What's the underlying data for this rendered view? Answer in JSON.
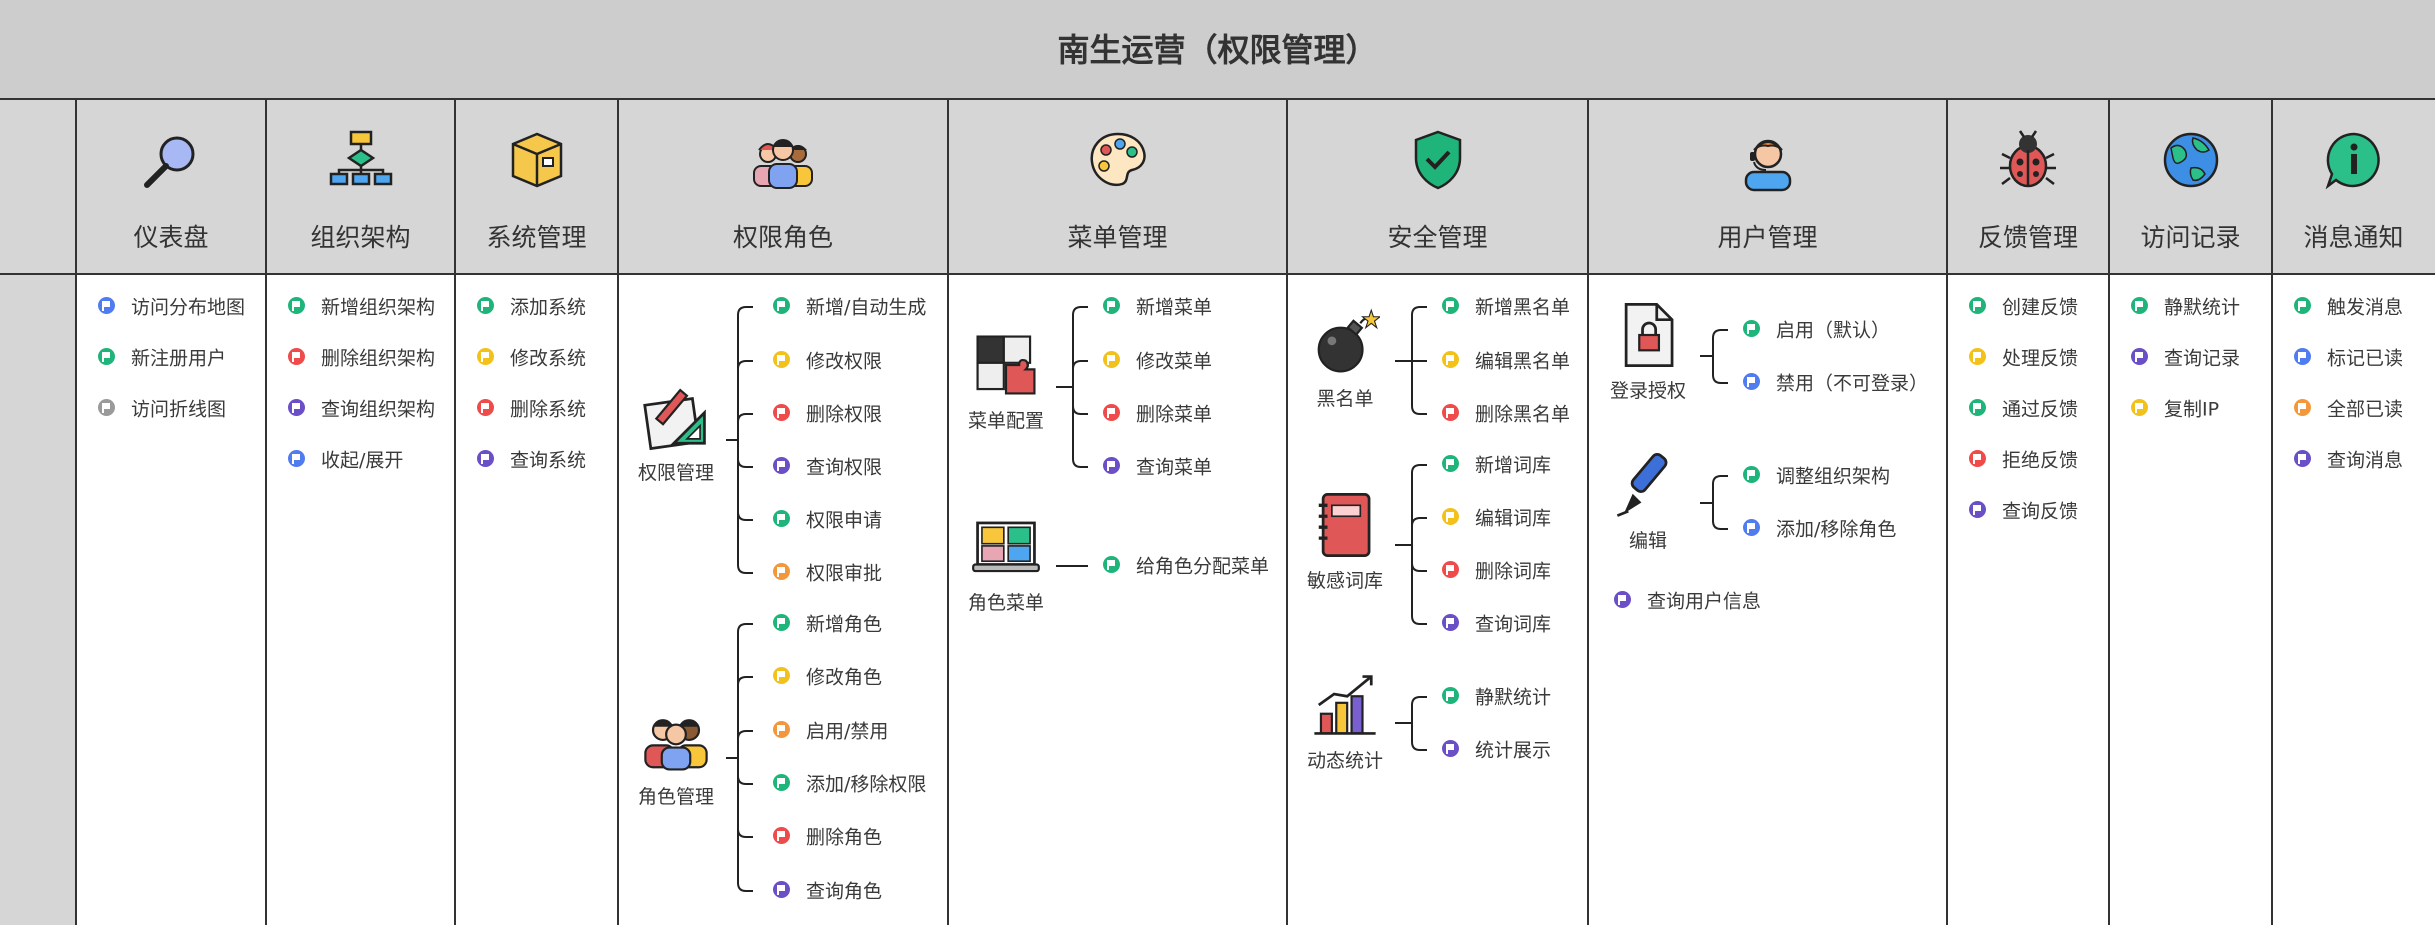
{
  "title": "南生运营（权限管理）",
  "colors": {
    "green": "#1fb57a",
    "yellow": "#f2c21b",
    "red": "#ef4b4b",
    "purple": "#6a4fc7",
    "blue": "#4f7cf0",
    "gray": "#9a9a9a",
    "orange": "#f4973a"
  },
  "columns": [
    {
      "label": "仪表盘",
      "icon": "magnifier-icon",
      "items": [
        {
          "text": "访问分布地图",
          "flag": "blue"
        },
        {
          "text": "新注册用户",
          "flag": "green"
        },
        {
          "text": "访问折线图",
          "flag": "gray"
        }
      ]
    },
    {
      "label": "组织架构",
      "icon": "org-chart-icon",
      "items": [
        {
          "text": "新增组织架构",
          "flag": "green"
        },
        {
          "text": "删除组织架构",
          "flag": "red"
        },
        {
          "text": "查询组织架构",
          "flag": "purple"
        },
        {
          "text": "收起/展开",
          "flag": "blue"
        }
      ]
    },
    {
      "label": "系统管理",
      "icon": "box-icon",
      "items": [
        {
          "text": "添加系统",
          "flag": "green"
        },
        {
          "text": "修改系统",
          "flag": "yellow"
        },
        {
          "text": "删除系统",
          "flag": "red"
        },
        {
          "text": "查询系统",
          "flag": "purple"
        }
      ]
    },
    {
      "label": "权限角色",
      "icon": "team-icon",
      "groups": [
        {
          "label": "权限管理",
          "icon": "pencil-ruler-icon",
          "items": [
            {
              "text": "新增/自动生成",
              "flag": "green"
            },
            {
              "text": "修改权限",
              "flag": "yellow"
            },
            {
              "text": "删除权限",
              "flag": "red"
            },
            {
              "text": "查询权限",
              "flag": "purple"
            },
            {
              "text": "权限申请",
              "flag": "green"
            },
            {
              "text": "权限审批",
              "flag": "orange"
            }
          ]
        },
        {
          "label": "角色管理",
          "icon": "people-icon",
          "items": [
            {
              "text": "新增角色",
              "flag": "green"
            },
            {
              "text": "修改角色",
              "flag": "yellow"
            },
            {
              "text": "启用/禁用",
              "flag": "orange"
            },
            {
              "text": "添加/移除权限",
              "flag": "green"
            },
            {
              "text": "删除角色",
              "flag": "red"
            },
            {
              "text": "查询角色",
              "flag": "purple"
            }
          ]
        }
      ]
    },
    {
      "label": "菜单管理",
      "icon": "palette-icon",
      "groups": [
        {
          "label": "菜单配置",
          "icon": "puzzle-icon",
          "items": [
            {
              "text": "新增菜单",
              "flag": "green"
            },
            {
              "text": "修改菜单",
              "flag": "yellow"
            },
            {
              "text": "删除菜单",
              "flag": "red"
            },
            {
              "text": "查询菜单",
              "flag": "purple"
            }
          ]
        },
        {
          "label": "角色菜单",
          "icon": "video-call-icon",
          "items": [
            {
              "text": "给角色分配菜单",
              "flag": "green"
            }
          ]
        }
      ]
    },
    {
      "label": "安全管理",
      "icon": "shield-check-icon",
      "groups": [
        {
          "label": "黑名单",
          "icon": "bomb-icon",
          "items": [
            {
              "text": "新增黑名单",
              "flag": "green"
            },
            {
              "text": "编辑黑名单",
              "flag": "yellow"
            },
            {
              "text": "删除黑名单",
              "flag": "red"
            }
          ]
        },
        {
          "label": "敏感词库",
          "icon": "notebook-icon",
          "items": [
            {
              "text": "新增词库",
              "flag": "green"
            },
            {
              "text": "编辑词库",
              "flag": "yellow"
            },
            {
              "text": "删除词库",
              "flag": "red"
            },
            {
              "text": "查询词库",
              "flag": "purple"
            }
          ]
        },
        {
          "label": "动态统计",
          "icon": "bar-chart-icon",
          "items": [
            {
              "text": "静默统计",
              "flag": "green"
            },
            {
              "text": "统计展示",
              "flag": "purple"
            }
          ]
        }
      ]
    },
    {
      "label": "用户管理",
      "icon": "user-headset-icon",
      "groups": [
        {
          "label": "登录授权",
          "icon": "locked-file-icon",
          "items": [
            {
              "text": "启用（默认）",
              "flag": "green"
            },
            {
              "text": "禁用（不可登录）",
              "flag": "blue"
            }
          ]
        },
        {
          "label": "编辑",
          "icon": "fountain-pen-icon",
          "items": [
            {
              "text": "调整组织架构",
              "flag": "green"
            },
            {
              "text": "添加/移除角色",
              "flag": "blue"
            }
          ]
        }
      ],
      "extra": [
        {
          "text": "查询用户信息",
          "flag": "purple"
        }
      ]
    },
    {
      "label": "反馈管理",
      "icon": "ladybug-icon",
      "items": [
        {
          "text": "创建反馈",
          "flag": "green"
        },
        {
          "text": "处理反馈",
          "flag": "yellow"
        },
        {
          "text": "通过反馈",
          "flag": "green"
        },
        {
          "text": "拒绝反馈",
          "flag": "red"
        },
        {
          "text": "查询反馈",
          "flag": "purple"
        }
      ]
    },
    {
      "label": "访问记录",
      "icon": "globe-icon",
      "items": [
        {
          "text": "静默统计",
          "flag": "green"
        },
        {
          "text": "查询记录",
          "flag": "purple"
        },
        {
          "text": "复制IP",
          "flag": "yellow"
        }
      ]
    },
    {
      "label": "消息通知",
      "icon": "info-bubble-icon",
      "items": [
        {
          "text": "触发消息",
          "flag": "green"
        },
        {
          "text": "标记已读",
          "flag": "blue"
        },
        {
          "text": "全部已读",
          "flag": "orange"
        },
        {
          "text": "查询消息",
          "flag": "purple"
        }
      ]
    }
  ]
}
